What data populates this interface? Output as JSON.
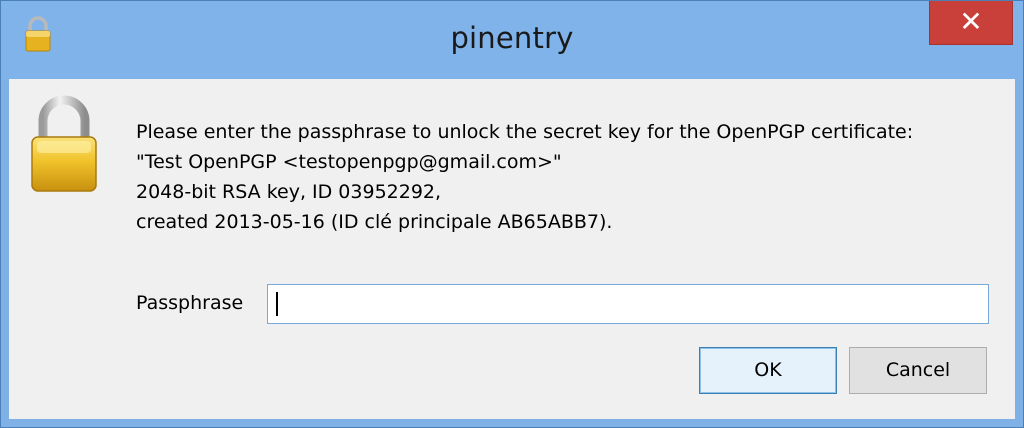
{
  "window": {
    "title": "pinentry",
    "close_label": "✕"
  },
  "message": {
    "lines": [
      "Please enter the passphrase to unlock the secret key for the OpenPGP certificate:",
      "\"Test OpenPGP <testopenpgp@gmail.com>\"",
      "2048-bit RSA key, ID 03952292,",
      "created 2013-05-16 (ID clé principale AB65ABB7)."
    ]
  },
  "passphrase": {
    "label": "Passphrase",
    "value": ""
  },
  "buttons": {
    "ok": "OK",
    "cancel": "Cancel"
  },
  "icons": {
    "title_icon": "lock-icon",
    "dialog_icon": "padlock-icon"
  },
  "colors": {
    "titlebar": "#7fb3ea",
    "close": "#c9403a",
    "client": "#f0f0f0",
    "input_border": "#7aa7de"
  }
}
